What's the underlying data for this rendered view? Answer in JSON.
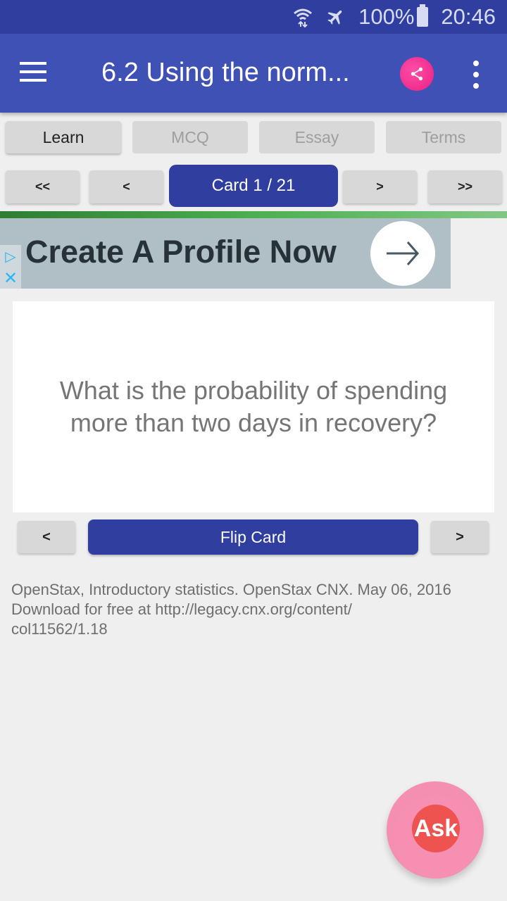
{
  "status_bar": {
    "wifi_icon": "wifi-data-icon",
    "airplane_icon": "airplane-mode-icon",
    "battery_percent": "100%",
    "battery_icon": "battery-full-icon",
    "time": "20:46"
  },
  "app_bar": {
    "menu_icon": "hamburger-menu-icon",
    "title": "6.2 Using the norm...",
    "share_icon": "share-icon",
    "more_icon": "more-vert-icon",
    "primary_color": "#3f51b5",
    "status_color": "#303f9f",
    "share_color": "#e91e82"
  },
  "tabs": [
    {
      "label": "Learn",
      "active": true
    },
    {
      "label": "MCQ",
      "active": false
    },
    {
      "label": "Essay",
      "active": false
    },
    {
      "label": "Terms",
      "active": false
    }
  ],
  "card_nav": {
    "first": "<<",
    "prev": "<",
    "counter": "Card 1 / 21",
    "next": ">",
    "last": ">>",
    "current": 1,
    "total": 21
  },
  "ad": {
    "text": "Create A Profile Now",
    "info_icon": "ad-choices-icon",
    "close_icon": "close-icon",
    "arrow_icon": "arrow-right-icon"
  },
  "flashcard": {
    "question": "What is the probability of spending more than two days in recovery?"
  },
  "flip_controls": {
    "prev": "<",
    "flip": "Flip Card",
    "next": ">"
  },
  "attribution": {
    "line1": "OpenStax, Introductory statistics. OpenStax CNX. May 06, 2016",
    "line2": "Download for free at http://legacy.cnx.org/content/",
    "line3": "col11562/1.18"
  },
  "fab": {
    "label": "Ask",
    "color": "#ef5350"
  }
}
